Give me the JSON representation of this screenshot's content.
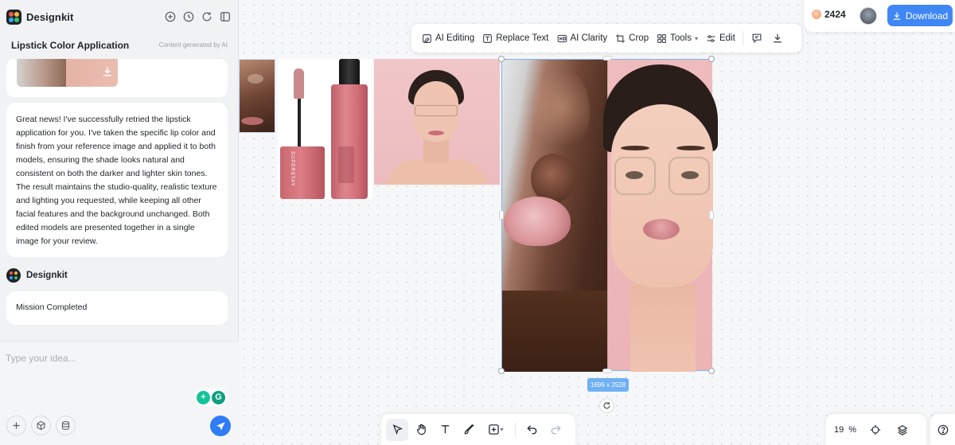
{
  "app": {
    "name": "Designkit",
    "conversation_title": "Lipstick Color Application",
    "ai_note": "Content generated by AI"
  },
  "chat": {
    "assistant_message": "Great news! I've successfully retried the lipstick application for you. I've taken the specific lip color and finish from your reference image and applied it to both models, ensuring the shade looks natural and consistent on both the darker and lighter skin tones. The result maintains the studio-quality, realistic texture and lighting you requested, while keeping all other facial features and the background unchanged. Both edited models are presented together in a single image for your review.",
    "agent_name": "Designkit",
    "status_message": "Mission Completed",
    "input_placeholder": "Type your idea..."
  },
  "toolbar": {
    "ai_editing": "AI Editing",
    "replace_text": "Replace Text",
    "ai_clarity": "AI Clarity",
    "crop": "Crop",
    "tools": "Tools",
    "edit": "Edit"
  },
  "account": {
    "credits": "2424",
    "download_label": "Download"
  },
  "canvas": {
    "selection_size": "1696 x 2528",
    "zoom_value": "19",
    "zoom_unit": "%"
  },
  "colors": {
    "accent": "#3f87f5",
    "send": "#2f7cf6",
    "selection": "#7fb1f7"
  },
  "icons": {
    "header": [
      "new-chat-icon",
      "history-icon",
      "refresh-icon",
      "sidebar-toggle-icon"
    ],
    "composer": [
      "plus-icon",
      "box-icon",
      "layers-stack-icon",
      "send-icon"
    ],
    "bottom_tools": [
      "select-pointer-icon",
      "hand-icon",
      "text-icon",
      "brush-icon",
      "frame-icon",
      "undo-icon",
      "redo-icon"
    ]
  }
}
